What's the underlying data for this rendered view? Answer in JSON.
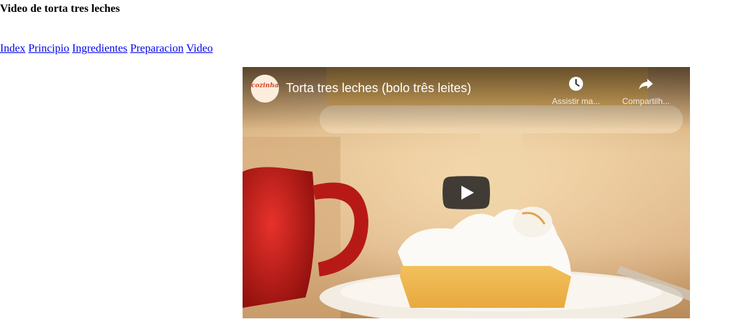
{
  "page": {
    "heading": "Video de torta tres leches"
  },
  "nav": {
    "links": [
      "Index",
      "Principio",
      "Ingredientes",
      "Preparacion",
      "Video"
    ]
  },
  "video": {
    "title": "Torta tres leches (bolo três leites)",
    "channel_logo_text": "cozinha",
    "actions": {
      "watch_later": "Assistir ma...",
      "share": "Compartilh..."
    },
    "icons": {
      "watch_later": "clock-icon",
      "share": "share-arrow-icon",
      "play": "play-icon"
    }
  },
  "colors": {
    "link": "#0000ee",
    "play_button": "#212121"
  }
}
